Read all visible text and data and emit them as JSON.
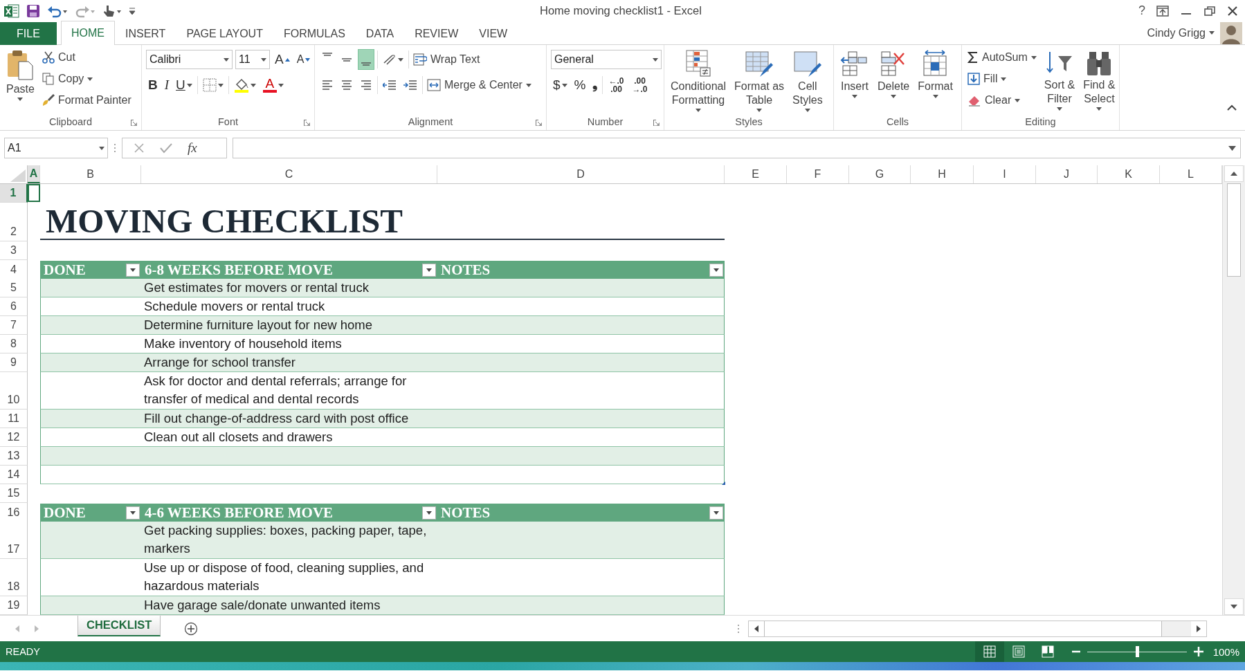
{
  "title_bar": {
    "title": "Home moving checklist1 - Excel",
    "help": "?",
    "user": "Cindy Grigg"
  },
  "ribbon_tabs": [
    {
      "label": "FILE",
      "kind": "file",
      "selected": false
    },
    {
      "label": "HOME",
      "kind": "tab",
      "selected": true
    },
    {
      "label": "INSERT",
      "kind": "tab",
      "selected": false
    },
    {
      "label": "PAGE LAYOUT",
      "kind": "tab",
      "selected": false
    },
    {
      "label": "FORMULAS",
      "kind": "tab",
      "selected": false
    },
    {
      "label": "DATA",
      "kind": "tab",
      "selected": false
    },
    {
      "label": "REVIEW",
      "kind": "tab",
      "selected": false
    },
    {
      "label": "VIEW",
      "kind": "tab",
      "selected": false
    }
  ],
  "clipboard": {
    "label": "Clipboard",
    "paste": "Paste",
    "cut": "Cut",
    "copy": "Copy",
    "format_painter": "Format Painter"
  },
  "font": {
    "label": "Font",
    "name": "Calibri",
    "size": "11",
    "grow": "A",
    "shrink": "A",
    "bold": "B",
    "italic": "I",
    "underline": "U",
    "font_color": "A"
  },
  "alignment": {
    "label": "Alignment",
    "vertical": [
      {
        "selected": false
      },
      {
        "selected": false
      },
      {
        "selected": true
      }
    ],
    "wrap_text": "Wrap Text",
    "merge_center": "Merge & Center"
  },
  "number": {
    "label": "Number",
    "format": "General",
    "currency": "$",
    "percent": "%",
    "comma": "❟",
    "increase_decimal": [
      "←.0",
      ".00"
    ],
    "decrease_decimal": [
      ".00",
      "→.0"
    ]
  },
  "styles": {
    "label": "Styles",
    "buttons": [
      {
        "lines": [
          "Conditional",
          "Formatting"
        ]
      },
      {
        "lines": [
          "Format as",
          "Table"
        ]
      },
      {
        "lines": [
          "Cell",
          "Styles"
        ]
      }
    ]
  },
  "cells": {
    "label": "Cells",
    "buttons": [
      {
        "lines": [
          "Insert"
        ]
      },
      {
        "lines": [
          "Delete"
        ]
      },
      {
        "lines": [
          "Format"
        ]
      }
    ]
  },
  "editing": {
    "label": "Editing",
    "autosum": "AutoSum",
    "fill": "Fill",
    "clear": "Clear",
    "sort_filter": [
      "Sort &",
      "Filter"
    ],
    "find_select": [
      "Find &",
      "Select"
    ]
  },
  "formula_bar": {
    "name_box": "A1",
    "fx": "fx"
  },
  "columns": [
    {
      "label": "A",
      "selected": true
    },
    {
      "label": "B",
      "selected": false
    },
    {
      "label": "C",
      "selected": false
    },
    {
      "label": "D",
      "selected": false
    },
    {
      "label": "E",
      "selected": false
    },
    {
      "label": "F",
      "selected": false
    },
    {
      "label": "G",
      "selected": false
    },
    {
      "label": "H",
      "selected": false
    },
    {
      "label": "I",
      "selected": false
    },
    {
      "label": "J",
      "selected": false
    },
    {
      "label": "K",
      "selected": false
    },
    {
      "label": "L",
      "selected": false
    }
  ],
  "rows": [
    {
      "number": "1",
      "kind": "blank",
      "selected": true
    },
    {
      "number": "2",
      "kind": "title",
      "text": "MOVING CHECKLIST",
      "selected": false
    },
    {
      "number": "3",
      "kind": "blank",
      "selected": false
    },
    {
      "number": "4",
      "kind": "header",
      "cells": [
        "DONE",
        "6-8 WEEKS BEFORE MOVE",
        "NOTES"
      ],
      "selected": false
    },
    {
      "number": "5",
      "kind": "item",
      "task": "Get estimates for movers or rental truck",
      "banded": true,
      "selected": false
    },
    {
      "number": "6",
      "kind": "item",
      "task": "Schedule movers or rental truck",
      "banded": false,
      "selected": false
    },
    {
      "number": "7",
      "kind": "item",
      "task": "Determine furniture layout for new home",
      "banded": true,
      "selected": false
    },
    {
      "number": "8",
      "kind": "item",
      "task": "Make inventory of household items",
      "banded": false,
      "selected": false
    },
    {
      "number": "9",
      "kind": "item",
      "task": "Arrange for school transfer",
      "banded": true,
      "selected": false
    },
    {
      "number": "10",
      "kind": "item",
      "task": "Ask for doctor and dental referrals; arrange for transfer of medical and dental records",
      "banded": false,
      "selected": false
    },
    {
      "number": "11",
      "kind": "item",
      "task": "Fill out change-of-address card with post office",
      "banded": true,
      "selected": false
    },
    {
      "number": "12",
      "kind": "item",
      "task": "Clean out all closets and drawers",
      "banded": false,
      "selected": false
    },
    {
      "number": "13",
      "kind": "item",
      "banded": true,
      "selected": false
    },
    {
      "number": "14",
      "kind": "item",
      "banded": false,
      "resize_handle": true,
      "selected": false
    },
    {
      "number": "15",
      "kind": "blank",
      "selected": false
    },
    {
      "number": "16",
      "kind": "header",
      "cells": [
        "DONE",
        "4-6 WEEKS BEFORE MOVE",
        "NOTES"
      ],
      "selected": false
    },
    {
      "number": "17",
      "kind": "item",
      "task": "Get packing supplies: boxes, packing paper, tape, markers",
      "banded": true,
      "selected": false
    },
    {
      "number": "18",
      "kind": "item",
      "task": "Use up or dispose of food, cleaning supplies, and hazardous materials",
      "banded": false,
      "selected": false
    },
    {
      "number": "19",
      "kind": "item",
      "task": "Have garage sale/donate unwanted items",
      "banded": true,
      "selected": false
    }
  ],
  "sheet_tabs": [
    {
      "label": "CHECKLIST",
      "selected": true
    }
  ],
  "status_bar": {
    "status": "READY",
    "views": [
      {
        "selected": true
      },
      {
        "selected": false
      },
      {
        "selected": false
      }
    ],
    "zoom": {
      "level": 0.5
    },
    "zoom_reading": "100%"
  }
}
